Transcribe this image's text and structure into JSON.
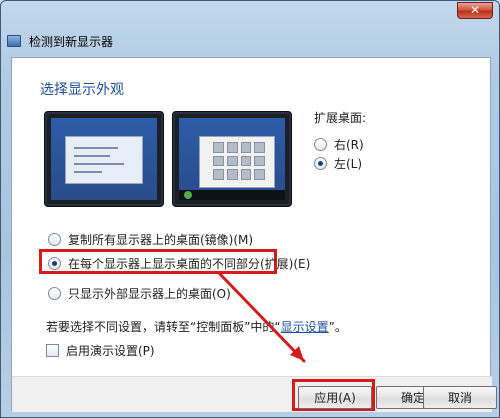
{
  "window": {
    "title": "检测到新显示器",
    "close_glyph": "✕",
    "heading": "选择显示外观"
  },
  "extend": {
    "label": "扩展桌面:",
    "options": [
      {
        "label": "右(R)",
        "selected": false
      },
      {
        "label": "左(L)",
        "selected": true
      }
    ]
  },
  "display_options": [
    {
      "label": "复制所有显示器上的桌面(镜像)(M)",
      "selected": false
    },
    {
      "label": "在每个显示器上显示桌面的不同部分(扩展)(E)",
      "selected": true
    },
    {
      "label": "只显示外部显示器上的桌面(O)",
      "selected": false
    }
  ],
  "hint": {
    "prefix": "若要选择不同设置，请转至“控制面板”中的“",
    "link": "显示设置",
    "suffix": "”。"
  },
  "checkbox": {
    "label": "启用演示设置(P)",
    "checked": false
  },
  "footer": {
    "apply": "应用(A)",
    "ok": "确定",
    "cancel": "取消"
  },
  "colors": {
    "accent": "#1b4f9c",
    "highlight": "#d51b1b",
    "window_frame": "#a9c4de"
  },
  "icons": {
    "app": "display-monitor-icon",
    "close": "close-icon"
  }
}
